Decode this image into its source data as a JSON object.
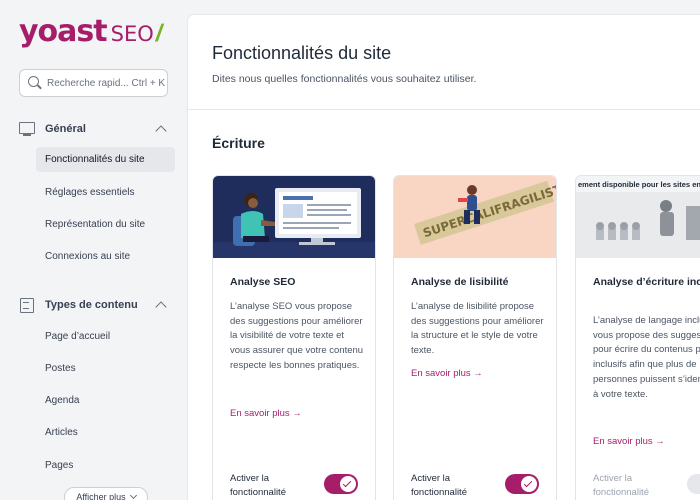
{
  "logo": {
    "brand": "yoast",
    "product": "SEO",
    "slash": "/"
  },
  "search": {
    "placeholder": "Recherche rapid... Ctrl + K"
  },
  "sidebar": {
    "groups": [
      {
        "title": "Général",
        "items": [
          {
            "label": "Fonctionnalités du site",
            "active": true
          },
          {
            "label": "Réglages essentiels"
          },
          {
            "label": "Représentation du site"
          },
          {
            "label": "Connexions au site"
          }
        ]
      },
      {
        "title": "Types de contenu",
        "items": [
          {
            "label": "Page d’accueil"
          },
          {
            "label": "Postes"
          },
          {
            "label": "Agenda"
          },
          {
            "label": "Articles"
          },
          {
            "label": "Pages"
          }
        ]
      }
    ],
    "show_more": "Afficher plus"
  },
  "main": {
    "title": "Fonctionnalités du site",
    "subtitle": "Dites nous quelles fonctionnalités vous souhaitez utiliser.",
    "section_title": "Écriture",
    "cards": [
      {
        "title": "Analyse SEO",
        "description": "L’analyse SEO vous propose des suggestions pour améliorer la visibilité de votre texte et vous assurer que votre contenu respecte les bonnes pratiques.",
        "link": "En savoir plus →",
        "toggle_label": "Activer la fonctionnalité",
        "enabled": true
      },
      {
        "title": "Analyse de lisibilité",
        "description": "L’analyse de lisibilité propose des suggestions pour améliorer la structure et le style de votre texte.",
        "link": "En savoir plus →",
        "toggle_label": "Activer la fonctionnalité",
        "enabled": true,
        "image_text": "SUPERCALIFRAGILISTIC"
      },
      {
        "title": "Analyse d’écriture inclusive",
        "description": "L’analyse de langage inclusif vous propose des suggestions pour écrire du contenus plus inclusifs afin que plus de personnes puissent s’identifier à votre texte.",
        "link": "En savoir plus →",
        "toggle_label": "Activer la fonctionnalité",
        "enabled": false,
        "image_banner": "ement disponible pour les sites en"
      }
    ]
  },
  "colors": {
    "brand": "#a61e69",
    "accent_green": "#77b227"
  }
}
